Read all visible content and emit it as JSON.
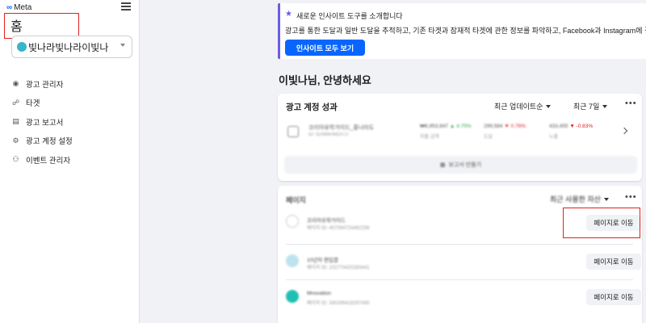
{
  "sidebar": {
    "brand": "Meta",
    "home_title": "홈",
    "account_name": "빛나라빛나라이빛나",
    "nav": [
      {
        "label": "광고 관리자",
        "icon": "ads-manager-icon"
      },
      {
        "label": "타겟",
        "icon": "audience-icon"
      },
      {
        "label": "광고 보고서",
        "icon": "report-icon"
      },
      {
        "label": "광고 계정 설정",
        "icon": "settings-icon"
      },
      {
        "label": "이벤트 관리자",
        "icon": "events-icon"
      }
    ]
  },
  "banner": {
    "title": "새로운 인사이트 도구를 소개합니다",
    "text": "광고를 통한 도달과 일반 도달을 추적하고, 기존 타겟과 잠재적 타겟에 관한 정보를 파악하고, Facebook과 Instagram에 걸친 콘",
    "button": "인사이트 모두 보기"
  },
  "greeting": "이빛나님, 안녕하세요",
  "performance": {
    "title": "광고 계정 성과",
    "sort_label": "최근 업데이트순",
    "period_label": "최근 7일",
    "row": {
      "name": "코리아유학가이드_홍나라도",
      "sub": "ID: 624890482072",
      "metric1": "₩6,953,647",
      "metric1_change": "▲ 4.75%",
      "metric1_sub": "지출 금액",
      "metric2": "299,584",
      "metric2_change": "▼ 0.76%",
      "metric2_sub": "도달",
      "metric3": "433,455",
      "metric3_change": "▼ -0.83%",
      "metric3_sub": "노출"
    },
    "report_button": "보고서 만들기"
  },
  "pages": {
    "title": "페이지",
    "sort_label": "최근 사용한 자산",
    "items": [
      {
        "name": "코리아유학가이드",
        "id": "페이지 ID: 457094724492256",
        "button": "페이지로 이동",
        "color": "#ffffff"
      },
      {
        "name": "10년차 편입클",
        "id": "페이지 ID: 102774420283441",
        "button": "페이지로 이동",
        "color": "#bde3ef"
      },
      {
        "name": "Mnovation",
        "id": "페이지 ID: 340299418297490",
        "button": "페이지로 이동",
        "color": "#1fbfb4"
      }
    ]
  },
  "colors": {
    "accent": "#0866ff",
    "highlight": "#e02020",
    "banner_border": "#6b5ce7"
  }
}
